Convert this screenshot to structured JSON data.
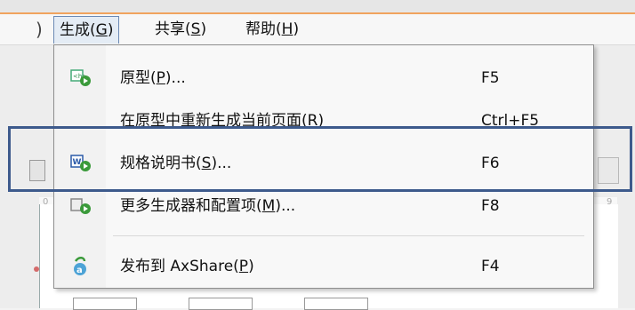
{
  "menubar": {
    "edge_glyph": ")",
    "items": [
      {
        "label": "生成(G)",
        "text": "生成(",
        "mnemonic": "G",
        "suffix": ")"
      },
      {
        "label": "共享(S)",
        "text": "共享(",
        "mnemonic": "S",
        "suffix": ")"
      },
      {
        "label": "帮助(H)",
        "text": "帮助(",
        "mnemonic": "H",
        "suffix": ")"
      }
    ]
  },
  "dropdown": {
    "items": [
      {
        "text": "原型(",
        "mnemonic": "P",
        "suffix": ")...",
        "shortcut": "F5",
        "icon": "prototype-icon"
      },
      {
        "text": "在原型中重新生成当前页面(R)",
        "mnemonic": "",
        "suffix": "",
        "shortcut": "Ctrl+F5",
        "icon": ""
      },
      {
        "text": "规格说明书(",
        "mnemonic": "S",
        "suffix": ")...",
        "shortcut": "F6",
        "icon": "word-spec-icon"
      },
      {
        "text": "更多生成器和配置项(",
        "mnemonic": "M",
        "suffix": ")...",
        "shortcut": "F8",
        "icon": "generator-icon"
      },
      {
        "text": "发布到 AxShare(",
        "mnemonic": "P",
        "suffix": ")",
        "shortcut": "F4",
        "icon": "axshare-icon"
      }
    ]
  },
  "background": {
    "tick_left_a": "0",
    "tick_right_a": "9"
  },
  "colors": {
    "accent": "#f0a35e",
    "highlight_border": "#3d5a8c",
    "menu_active_bg": "#e4ecf5"
  }
}
